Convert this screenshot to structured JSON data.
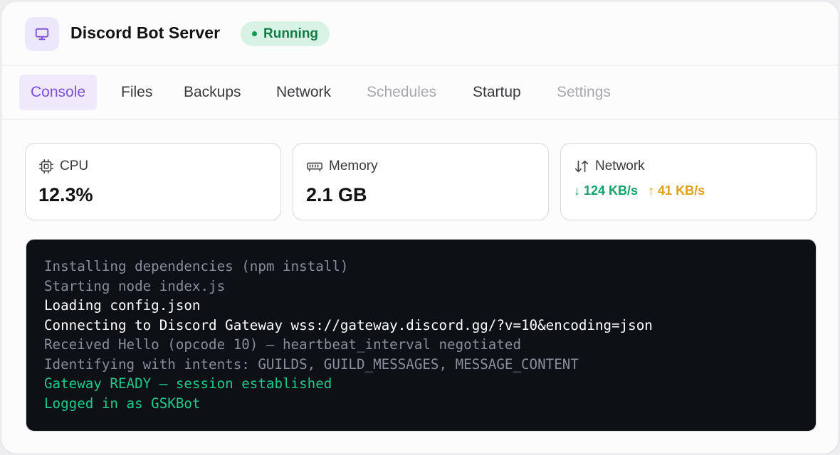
{
  "header": {
    "icon": "monitor-icon",
    "title": "Discord Bot Server",
    "status": "Running",
    "status_color": "#109a55"
  },
  "tabs": [
    {
      "label": "Console",
      "state": "active"
    },
    {
      "label": "Files",
      "state": "normal"
    },
    {
      "label": "Backups",
      "state": "normal"
    },
    {
      "label": "Network",
      "state": "normal"
    },
    {
      "label": "Schedules",
      "state": "disabled"
    },
    {
      "label": "Startup",
      "state": "normal"
    },
    {
      "label": "Settings",
      "state": "disabled"
    }
  ],
  "stats": {
    "cpu": {
      "icon": "cpu-icon",
      "label": "CPU",
      "value": "12.3%"
    },
    "memory": {
      "icon": "memory-icon",
      "label": "Memory",
      "value": "2.1 GB"
    },
    "network": {
      "icon": "arrows-up-down-icon",
      "label": "Network",
      "down": "↓ 124 KB/s",
      "up": "↑ 41 KB/s"
    }
  },
  "colors": {
    "accent": "#7d4fd6",
    "download": "#10a36a",
    "upload": "#e0a012",
    "console_bg": "#0d1015"
  },
  "console": {
    "lines": [
      {
        "text": "Installing dependencies (npm install)",
        "style": "dim"
      },
      {
        "text": "Starting node index.js",
        "style": "dim"
      },
      {
        "text": "Loading config.json",
        "style": "bright"
      },
      {
        "text": "Connecting to Discord Gateway wss://gateway.discord.gg/?v=10&encoding=json",
        "style": "bright"
      },
      {
        "text": "Received Hello (opcode 10) — heartbeat_interval negotiated",
        "style": "dim"
      },
      {
        "text": "Identifying with intents: GUILDS, GUILD_MESSAGES, MESSAGE_CONTENT",
        "style": "dim"
      },
      {
        "text": "Gateway READY — session established",
        "style": "ok"
      },
      {
        "text": "Logged in as GSKBot",
        "style": "ok"
      }
    ]
  }
}
